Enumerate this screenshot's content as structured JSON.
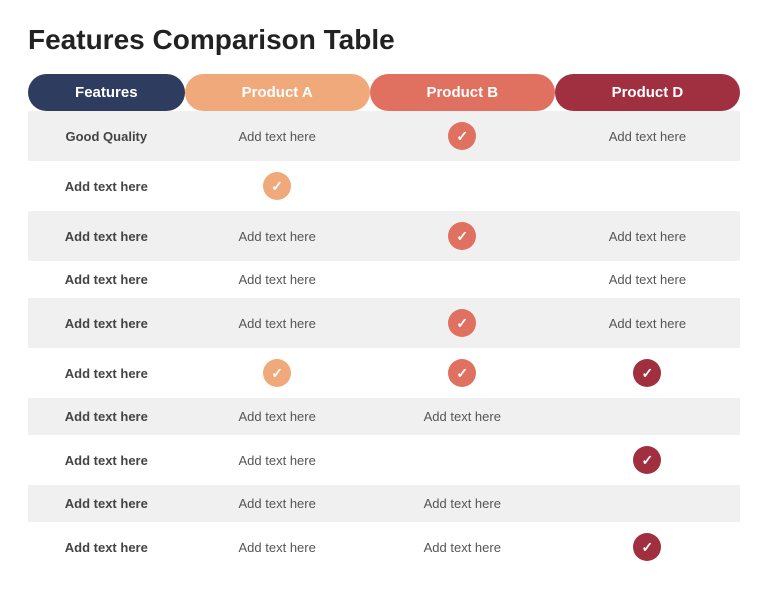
{
  "title": "Features Comparison Table",
  "header": {
    "col0": "Features",
    "col1": "Product A",
    "col2": "Product B",
    "col3": "Product D"
  },
  "rows": [
    {
      "feature": "Good Quality",
      "a": {
        "type": "text",
        "value": "Add text here"
      },
      "b": {
        "type": "check",
        "style": "red"
      },
      "d": {
        "type": "text",
        "value": "Add text here"
      }
    },
    {
      "feature": "Add text here",
      "a": {
        "type": "check",
        "style": "orange"
      },
      "b": {
        "type": "empty"
      },
      "d": {
        "type": "empty"
      }
    },
    {
      "feature": "Add text here",
      "a": {
        "type": "text",
        "value": "Add text here"
      },
      "b": {
        "type": "check",
        "style": "red"
      },
      "d": {
        "type": "text",
        "value": "Add text here"
      }
    },
    {
      "feature": "Add text here",
      "a": {
        "type": "text",
        "value": "Add text here"
      },
      "b": {
        "type": "empty"
      },
      "d": {
        "type": "text",
        "value": "Add text here"
      }
    },
    {
      "feature": "Add text here",
      "a": {
        "type": "text",
        "value": "Add text here"
      },
      "b": {
        "type": "check",
        "style": "red"
      },
      "d": {
        "type": "text",
        "value": "Add text here"
      }
    },
    {
      "feature": "Add text here",
      "a": {
        "type": "check",
        "style": "orange"
      },
      "b": {
        "type": "check",
        "style": "red"
      },
      "d": {
        "type": "check",
        "style": "darkred"
      }
    },
    {
      "feature": "Add text here",
      "a": {
        "type": "text",
        "value": "Add text here"
      },
      "b": {
        "type": "text",
        "value": "Add text here"
      },
      "d": {
        "type": "empty"
      }
    },
    {
      "feature": "Add text here",
      "a": {
        "type": "text",
        "value": "Add text here"
      },
      "b": {
        "type": "empty"
      },
      "d": {
        "type": "check",
        "style": "darkred"
      }
    },
    {
      "feature": "Add text here",
      "a": {
        "type": "text",
        "value": "Add text here"
      },
      "b": {
        "type": "text",
        "value": "Add text here"
      },
      "d": {
        "type": "empty"
      }
    },
    {
      "feature": "Add text here",
      "a": {
        "type": "text",
        "value": "Add text here"
      },
      "b": {
        "type": "text",
        "value": "Add text here"
      },
      "d": {
        "type": "check",
        "style": "darkred"
      }
    }
  ]
}
